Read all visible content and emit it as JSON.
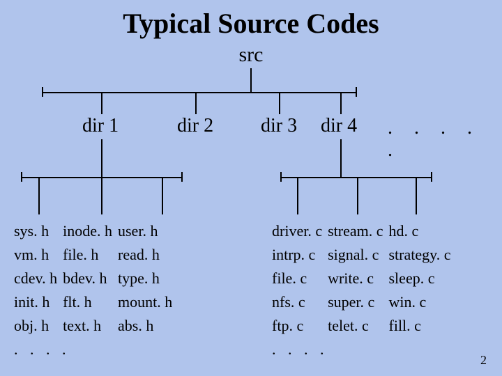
{
  "title": "Typical Source Codes",
  "root": "src",
  "dirs": [
    "dir 1",
    "dir 2",
    "dir 3",
    "dir 4"
  ],
  "dots_top": ".  .  .  .  .",
  "left_files": {
    "col1": [
      "sys. h",
      "vm. h",
      "cdev. h",
      "init. h",
      "obj. h"
    ],
    "col2": [
      "inode. h",
      "file. h",
      "bdev. h",
      "flt. h",
      "text. h"
    ],
    "col3": [
      "user. h",
      "read. h",
      "type. h",
      "mount. h",
      "abs. h"
    ],
    "ellipsis": ".  .  .  ."
  },
  "right_files": {
    "col1": [
      "driver. c",
      "intrp. c",
      "file. c",
      "nfs. c",
      "ftp. c"
    ],
    "col2": [
      "stream. c",
      "signal. c",
      "write. c",
      "super. c",
      "telet. c"
    ],
    "col3": [
      "hd. c",
      "strategy. c",
      "sleep. c",
      "win. c",
      "fill. c"
    ],
    "ellipsis": ".  .  .  ."
  },
  "page_number": "2"
}
